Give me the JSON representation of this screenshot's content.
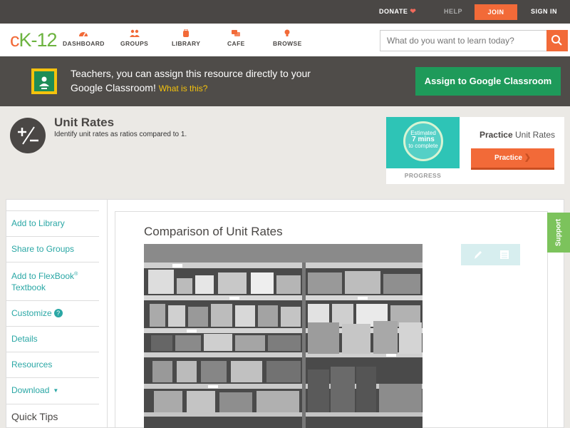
{
  "topbar": {
    "donate": "DONATE",
    "help": "HELP",
    "join": "JOIN",
    "sign_in": "SIGN IN"
  },
  "nav": {
    "logo_c": "c",
    "logo_k": "K-12",
    "items": [
      {
        "label": "DASHBOARD",
        "icon": "gauge-icon"
      },
      {
        "label": "GROUPS",
        "icon": "people-icon"
      },
      {
        "label": "LIBRARY",
        "icon": "backpack-icon"
      },
      {
        "label": "CAFE",
        "icon": "chat-bubbles-icon"
      },
      {
        "label": "BROWSE",
        "icon": "lightbulb-icon"
      }
    ],
    "search_placeholder": "What do you want to learn today?"
  },
  "banner": {
    "text": "Teachers, you can assign this resource directly to your Google Classroom!",
    "what_link": "What is this?",
    "assign_button": "Assign to Google Classroom"
  },
  "concept": {
    "title": "Unit Rates",
    "description": "Identify unit rates as ratios compared to 1."
  },
  "practice": {
    "estimated_line1": "Estimated",
    "estimated_line2": "7 mins",
    "estimated_line3": "to complete",
    "progress_label": "PROGRESS",
    "title_bold": "Practice",
    "title_rest": "Unit Rates",
    "button": "Practice"
  },
  "sidebar": {
    "items": [
      {
        "label": "Add to Library"
      },
      {
        "label": "Share to Groups"
      },
      {
        "label": "Add to FlexBook",
        "sup": "®",
        "line2": "Textbook"
      },
      {
        "label": "Customize",
        "badge": "?"
      },
      {
        "label": "Details"
      },
      {
        "label": "Resources"
      },
      {
        "label": "Download"
      },
      {
        "label": "Quick Tips"
      }
    ]
  },
  "main": {
    "title": "Comparison of Unit Rates"
  },
  "support": "Support",
  "colors": {
    "accent_orange": "#f26a38",
    "teal_link": "#2aa7a5",
    "google_green": "#1e9a5a",
    "support_green": "#7cc35c"
  }
}
